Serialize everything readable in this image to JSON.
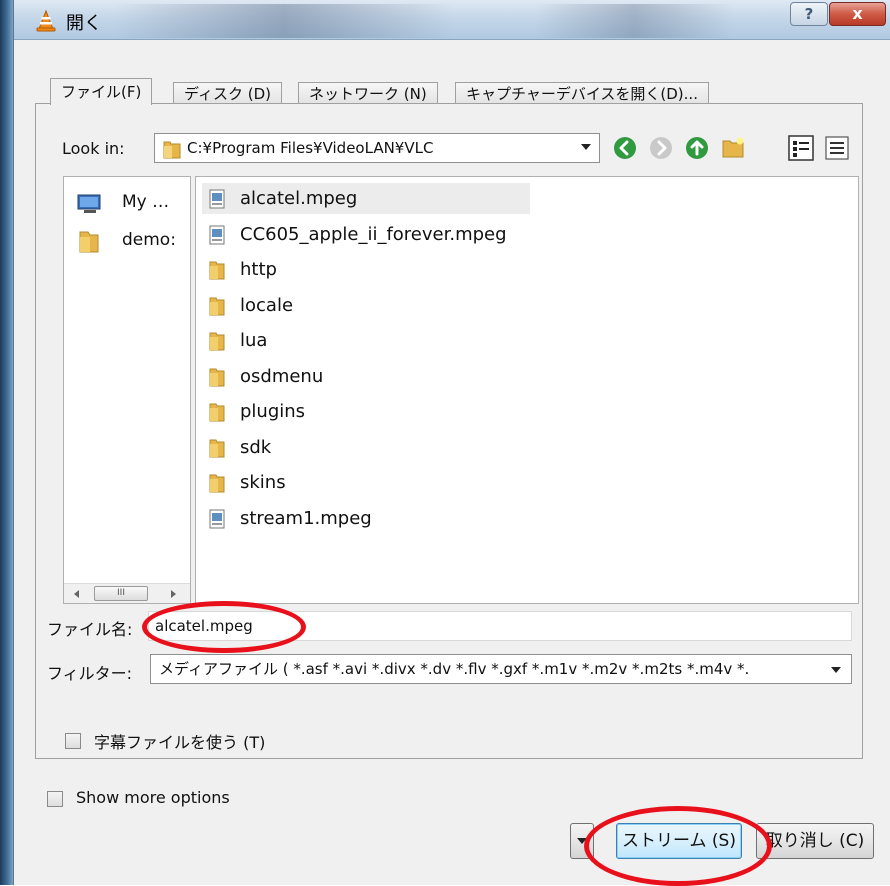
{
  "window": {
    "title": "開く",
    "help_label": "?",
    "close_label": "x"
  },
  "tabs": [
    {
      "label": "ファイル(F)",
      "active": true
    },
    {
      "label": "ディスク (D)",
      "active": false
    },
    {
      "label": "ネットワーク (N)",
      "active": false
    },
    {
      "label": "キャプチャーデバイスを開く(D)...",
      "active": false
    }
  ],
  "look_in": {
    "label": "Look in:",
    "path": "C:¥Program Files¥VideoLAN¥VLC"
  },
  "toolbar": {
    "icons": [
      "back-icon",
      "forward-icon",
      "up-folder-icon",
      "new-folder-icon",
      "list-view-icon",
      "detail-view-icon"
    ]
  },
  "places": [
    {
      "name": "My …",
      "icon": "computer-icon"
    },
    {
      "name": "demo:",
      "icon": "folder-icon"
    }
  ],
  "places_scroll_label": "III",
  "files": [
    {
      "name": "alcatel.mpeg",
      "type": "file",
      "selected": true
    },
    {
      "name": "CC605_apple_ii_forever.mpeg",
      "type": "file",
      "selected": false
    },
    {
      "name": "http",
      "type": "folder",
      "selected": false
    },
    {
      "name": "locale",
      "type": "folder",
      "selected": false
    },
    {
      "name": "lua",
      "type": "folder",
      "selected": false
    },
    {
      "name": "osdmenu",
      "type": "folder",
      "selected": false
    },
    {
      "name": "plugins",
      "type": "folder",
      "selected": false
    },
    {
      "name": "sdk",
      "type": "folder",
      "selected": false
    },
    {
      "name": "skins",
      "type": "folder",
      "selected": false
    },
    {
      "name": "stream1.mpeg",
      "type": "file",
      "selected": false
    }
  ],
  "filename": {
    "label": "ファイル名:",
    "value": "alcatel.mpeg"
  },
  "filter": {
    "label": "フィルター:",
    "value": "メディアファイル ( *.asf *.avi *.divx *.dv *.flv *.gxf *.m1v *.m2v *.m2ts *.m4v *."
  },
  "subtitle_checkbox": {
    "label": "字幕ファイルを使う (T)",
    "checked": false
  },
  "more_options_checkbox": {
    "label": "Show more options",
    "checked": false
  },
  "buttons": {
    "stream_label": "ストリーム (S)",
    "cancel_label": "取り消し (C)"
  },
  "colors": {
    "annotation_ring": "#e8111b",
    "folder": "#e6b64a"
  }
}
